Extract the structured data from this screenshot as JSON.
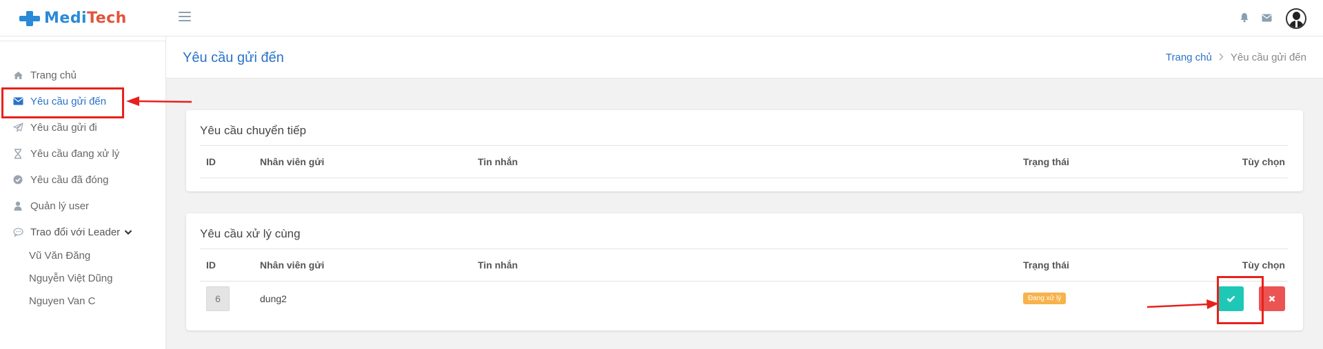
{
  "app": {
    "logo_part1": "Medi",
    "logo_part2": "Tech"
  },
  "colors": {
    "accent": "#2a72c8",
    "logo_blue": "#2a8ad8",
    "logo_red": "#e2533b",
    "status_pending": "#f7b24a",
    "accept": "#1fc7b6",
    "reject": "#ec5453",
    "annotation": "#e8201b"
  },
  "header": {
    "icons": [
      "menu-icon",
      "bell-icon",
      "envelope-icon",
      "user-avatar"
    ]
  },
  "sidebar": {
    "items": [
      {
        "label": "Trang chủ",
        "icon": "home-icon"
      },
      {
        "label": "Yêu cầu gửi đến",
        "icon": "envelope-icon",
        "active": true
      },
      {
        "label": "Yêu cầu gửi đi",
        "icon": "paper-plane-icon"
      },
      {
        "label": "Yêu cầu đang xử lý",
        "icon": "hourglass-icon"
      },
      {
        "label": "Yêu cầu đã đóng",
        "icon": "check-circle-icon"
      },
      {
        "label": "Quản lý user",
        "icon": "user-icon"
      },
      {
        "label": "Trao đổi với Leader",
        "icon": "chat-icon",
        "expanded": true
      }
    ],
    "leaders": [
      "Vũ Văn Đăng",
      "Nguyễn Việt Dũng",
      "Nguyen Van C"
    ]
  },
  "page": {
    "title": "Yêu cầu gửi đến",
    "breadcrumb_home": "Trang chủ",
    "breadcrumb_current": "Yêu cầu gửi đến"
  },
  "tables": {
    "forwarded": {
      "title": "Yêu cầu chuyển tiếp",
      "columns": [
        "ID",
        "Nhân viên gửi",
        "Tin nhắn",
        "Trạng thái",
        "Tùy chọn"
      ],
      "rows": []
    },
    "shared": {
      "title": "Yêu cầu xử lý cùng",
      "columns": [
        "ID",
        "Nhân viên gửi",
        "Tin nhắn",
        "Trạng thái",
        "Tùy chọn"
      ],
      "rows": [
        {
          "id": "6",
          "sender": "dung2",
          "message": "",
          "status": "Đang xử lý",
          "actions": [
            "check-icon",
            "close-icon"
          ]
        }
      ]
    }
  }
}
